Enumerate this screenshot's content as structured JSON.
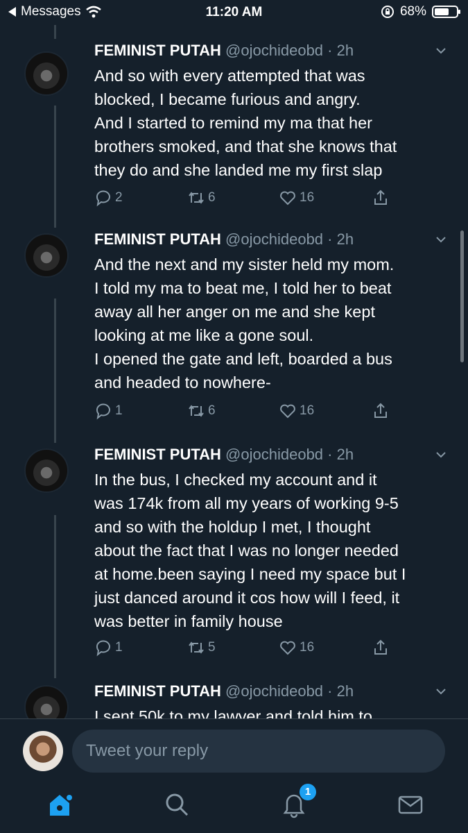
{
  "status_bar": {
    "back_label": "Messages",
    "time": "11:20 AM",
    "battery": "68%"
  },
  "tweets": [
    {
      "name": "FEMINIST PUTAH",
      "handle": "@ojochideobd · 2h",
      "text": "And so with every attempted that was\nblocked, I became furious and angry.\nAnd I started to remind my ma that her\nbrothers smoked, and that she knows that\nthey do and she landed me my first slap",
      "replies": "2",
      "retweets": "6",
      "likes": "16"
    },
    {
      "name": "FEMINIST PUTAH",
      "handle": "@ojochideobd · 2h",
      "text": "And the next and my sister held my mom.\nI told my ma to beat me, I told her to beat\naway all her anger on me and she kept\nlooking at me like a gone soul.\nI opened the gate and left, boarded a bus\nand headed to nowhere-",
      "replies": "1",
      "retweets": "6",
      "likes": "16"
    },
    {
      "name": "FEMINIST PUTAH",
      "handle": "@ojochideobd · 2h",
      "text": "In the bus, I checked my account and it\nwas 174k from all my years of working 9-5\nand so with the holdup I met, I thought\nabout the fact that I was no longer needed\nat home.been saying I need my space but I\njust danced around it cos how will I feed, it\nwas better in family house",
      "replies": "1",
      "retweets": "5",
      "likes": "16"
    },
    {
      "name": "FEMINIST PUTAH",
      "handle": "@ojochideobd · 2h",
      "text": "I sent 50k to my lawyer and told him to",
      "replies": "",
      "retweets": "",
      "likes": ""
    }
  ],
  "reply": {
    "placeholder": "Tweet your reply"
  },
  "tabbar": {
    "items": [
      "home-icon",
      "search-icon",
      "notifications-icon",
      "messages-icon"
    ],
    "notification_count": "1"
  },
  "colors": {
    "background": "#15202b",
    "accent": "#1da1f2",
    "secondary_text": "#8899a6"
  }
}
